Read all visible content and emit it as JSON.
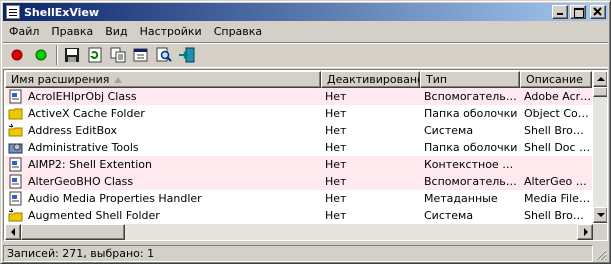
{
  "window": {
    "title": "ShellExView"
  },
  "menu": [
    "Файл",
    "Правка",
    "Вид",
    "Настройки",
    "Справка"
  ],
  "toolbar": {
    "buttons": [
      "enable-icon",
      "disable-icon",
      "save-icon",
      "refresh-icon",
      "copy-icon",
      "properties-icon",
      "find-icon",
      "exit-icon"
    ]
  },
  "table": {
    "columns": [
      "Имя расширения",
      "Деактивировано",
      "Тип",
      "Описание"
    ],
    "rows": [
      {
        "icon": "dll-icon",
        "name": "AcroIEHlprObj Class",
        "disabled": "Нет",
        "type": "Вспомогательн...",
        "desc": "Adobe Acroba",
        "highlight": true
      },
      {
        "icon": "folder-icon",
        "name": "ActiveX Cache Folder",
        "disabled": "Нет",
        "type": "Папка оболочки",
        "desc": "Object Contro",
        "highlight": false
      },
      {
        "icon": "address-editbox-icon",
        "name": "Address EditBox",
        "disabled": "Нет",
        "type": "Система",
        "desc": "Shell Browser U",
        "highlight": false
      },
      {
        "icon": "admin-tools-icon",
        "name": "Administrative Tools",
        "disabled": "Нет",
        "type": "Папка оболочки",
        "desc": "Shell Doc Obje",
        "highlight": false
      },
      {
        "icon": "dll-icon",
        "name": "AIMP2: Shell Extention",
        "disabled": "Нет",
        "type": "Контекстное м...",
        "desc": "",
        "highlight": true
      },
      {
        "icon": "dll-icon",
        "name": "AlterGeoBHO Class",
        "disabled": "Нет",
        "type": "Вспомогательн...",
        "desc": "AlterGeo brow",
        "highlight": true
      },
      {
        "icon": "dll-icon",
        "name": "Audio Media Properties Handler",
        "disabled": "Нет",
        "type": "Метаданные",
        "desc": "Media File Prop",
        "highlight": false
      },
      {
        "icon": "augmented-folder-icon",
        "name": "Augmented Shell Folder",
        "disabled": "Нет",
        "type": "Система",
        "desc": "Shell Browser U",
        "highlight": false
      }
    ]
  },
  "status": {
    "text": "Записей: 271, выбрано: 1"
  }
}
